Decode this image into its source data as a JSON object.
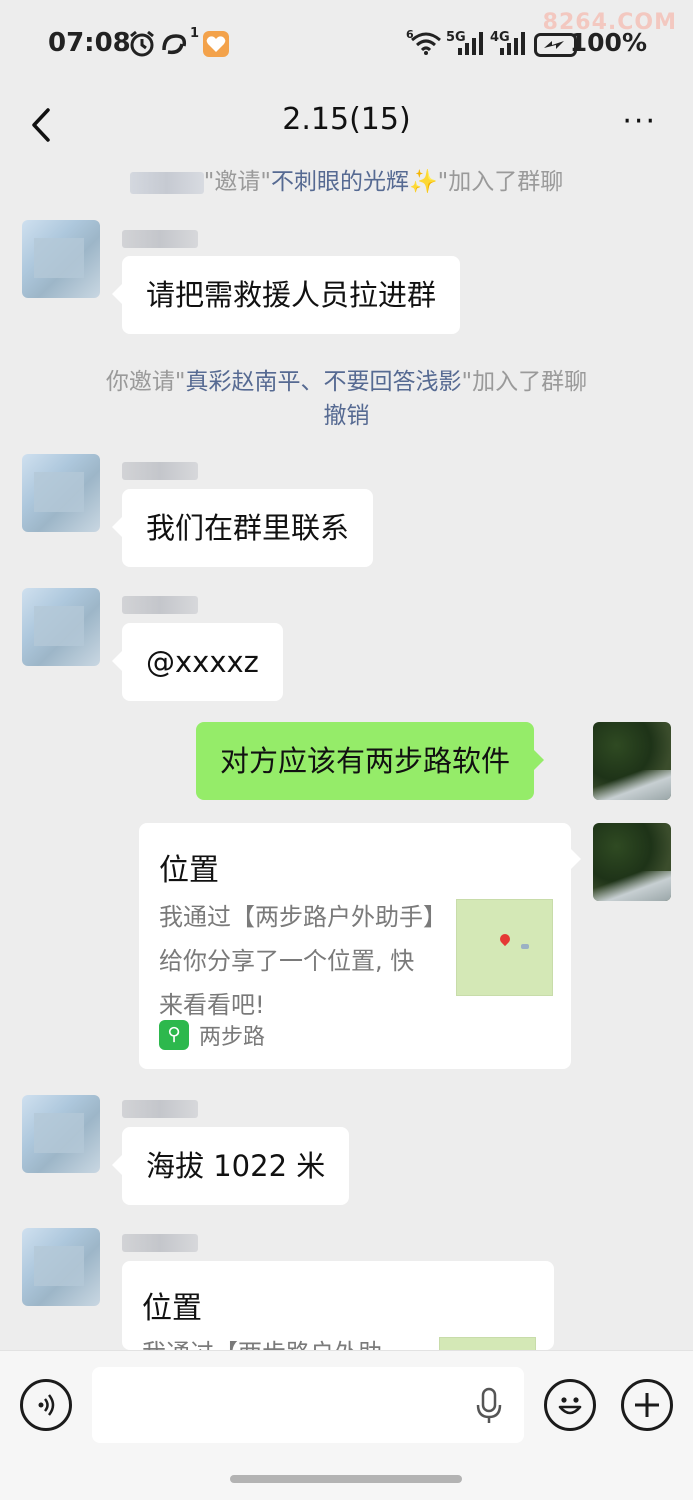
{
  "status_bar": {
    "time": "07:08",
    "battery": "100%",
    "network_1": "5G",
    "network_2": "4G",
    "wifi_badge": "6",
    "notif_count": "1",
    "watermark": "8264.COM"
  },
  "header": {
    "title": "2.15(15)",
    "more": "···"
  },
  "system_messages": {
    "invite_1_pre": "\"邀请\"",
    "invite_1_name": "不刺眼的光辉✨",
    "invite_1_post": "\"加入了群聊",
    "invite_2_pre": "你邀请\"",
    "invite_2_name": "真彩赵南平、不要回答浅影",
    "invite_2_post": "\"加入了群聊",
    "revoke": "撤销"
  },
  "messages": {
    "m1": "请把需救援人员拉进群",
    "m2": "我们在群里联系",
    "m3": "@xxxxz",
    "m4": "对方应该有两步路软件",
    "card1": {
      "title": "位置",
      "desc": "我通过【两步路户外助手】给你分享了一个位置, 快来看看吧!",
      "app": "两步路"
    },
    "m5": "海拔 1022 米",
    "card2": {
      "title": "位置",
      "desc_partial": "我通过【两步路户外助"
    }
  },
  "icons": {
    "back": "chevron-left-icon",
    "more": "more-icon",
    "voice": "voice-icon",
    "emoji": "emoji-icon",
    "plus": "plus-icon",
    "mic": "mic-icon"
  },
  "colors": {
    "green_bubble": "#95ec69",
    "link": "#566a92"
  }
}
